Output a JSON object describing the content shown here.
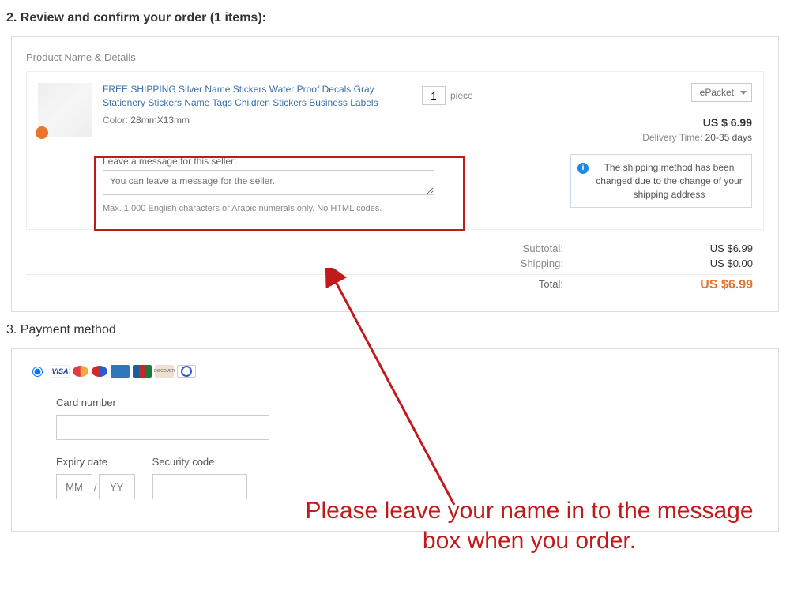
{
  "review": {
    "title": "2. Review and confirm your order (1 items):",
    "details_header": "Product Name & Details",
    "product": {
      "title": "FREE SHIPPING Silver Name Stickers Water Proof Decals Gray Stationery Stickers Name Tags Children Stickers Business Labels",
      "color_label": "Color:",
      "color_value": "28mmX13mm",
      "qty": "1",
      "unit": "piece",
      "shipping_method": "ePacket",
      "price": "US $ 6.99",
      "delivery_label": "Delivery Time:",
      "delivery_value": "20-35 days",
      "shipping_notice": "The shipping method has been changed due to the change of your shipping address"
    },
    "message": {
      "label": "Leave a message for this seller:",
      "placeholder": "You can leave a message for the seller.",
      "help": "Max. 1,000 English characters or Arabic numerals only. No HTML codes."
    },
    "totals": {
      "subtotal_label": "Subtotal:",
      "subtotal_value": "US $6.99",
      "shipping_label": "Shipping:",
      "shipping_value": "US $0.00",
      "total_label": "Total:",
      "total_value": "US $6.99"
    }
  },
  "payment": {
    "title": "3. Payment method",
    "cards": {
      "visa": "VISA",
      "discover": "DISCOVER"
    },
    "card_number_label": "Card number",
    "expiry_label": "Expiry date",
    "security_label": "Security code",
    "mm_placeholder": "MM",
    "yy_placeholder": "YY",
    "slash": "/"
  },
  "annotation": {
    "text": "Please leave your name in to the message box when you order."
  }
}
